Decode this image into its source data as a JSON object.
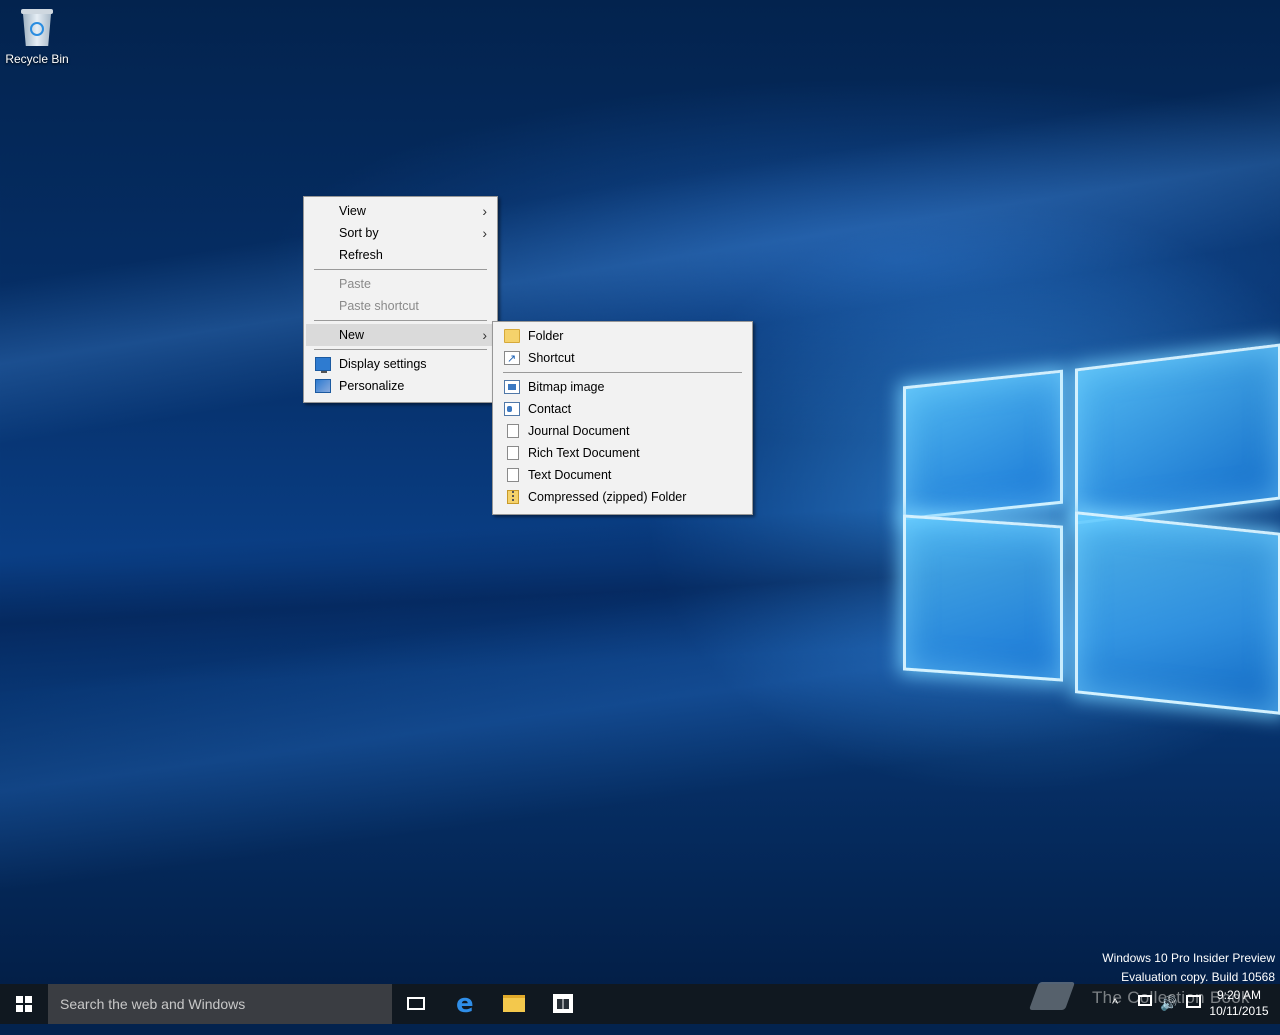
{
  "desktop": {
    "icons": [
      {
        "label": "Recycle Bin",
        "icon": "recycle-bin-icon"
      }
    ]
  },
  "context_menu": {
    "items": [
      {
        "label": "View",
        "submenu": true
      },
      {
        "label": "Sort by",
        "submenu": true
      },
      {
        "label": "Refresh"
      },
      {
        "label": "Paste",
        "disabled": true
      },
      {
        "label": "Paste shortcut",
        "disabled": true
      },
      {
        "label": "New",
        "submenu": true,
        "highlighted": true
      },
      {
        "label": "Display settings",
        "icon": "display-settings-icon"
      },
      {
        "label": "Personalize",
        "icon": "personalize-icon"
      }
    ]
  },
  "new_submenu": {
    "items": [
      {
        "label": "Folder",
        "icon": "folder-icon"
      },
      {
        "label": "Shortcut",
        "icon": "shortcut-icon"
      },
      {
        "label": "Bitmap image",
        "icon": "bitmap-icon"
      },
      {
        "label": "Contact",
        "icon": "contact-icon"
      },
      {
        "label": "Journal Document",
        "icon": "journal-icon"
      },
      {
        "label": "Rich Text Document",
        "icon": "rich-text-icon"
      },
      {
        "label": "Text Document",
        "icon": "text-document-icon"
      },
      {
        "label": "Compressed (zipped) Folder",
        "icon": "zip-folder-icon"
      }
    ]
  },
  "watermark": {
    "line1": "Windows 10 Pro Insider Preview",
    "line2": "Evaluation copy. Build 10568"
  },
  "taskbar": {
    "search_placeholder": "Search the web and Windows",
    "time": "9:20 AM",
    "date": "10/11/2015",
    "chevron": "^",
    "volume": "🔊"
  },
  "branding": {
    "text": "The Collection Book"
  },
  "colors": {
    "menu_bg": "#f2f2f2",
    "taskbar_bg": "#101820",
    "search_bg": "#3a3d42",
    "accent": "#2f8ee8"
  }
}
